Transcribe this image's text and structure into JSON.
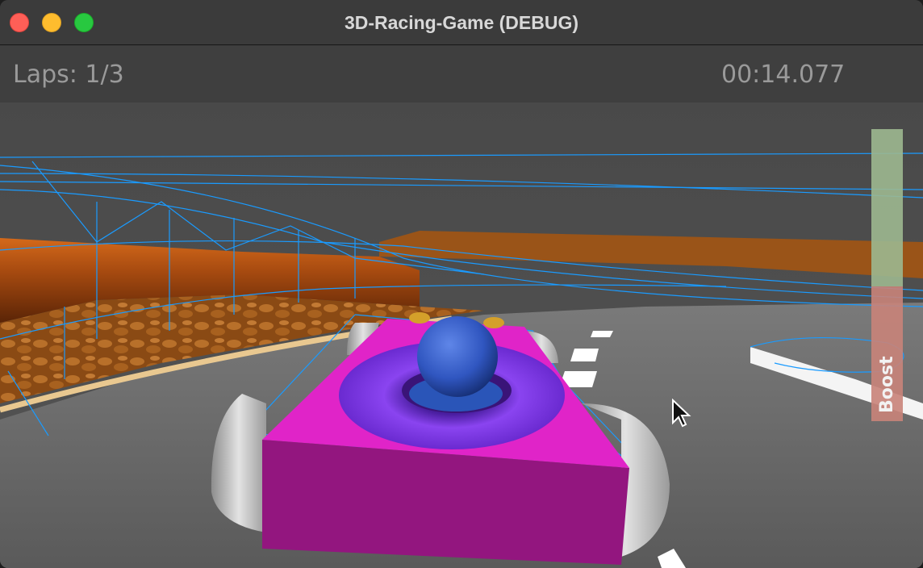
{
  "window": {
    "title": "3D-Racing-Game (DEBUG)"
  },
  "hud": {
    "laps": "Laps: 1/3",
    "timer": "00:14.077"
  },
  "boost": {
    "label": "Boost",
    "level": 0.46
  },
  "colors": {
    "kart_body": "#d61fc2",
    "kart_front": "#92157f",
    "ring": "#7a36e6",
    "driver": "#3a63cf",
    "wireframe": "#1a9bff",
    "track_wall": "#c65a14",
    "road": "#6b6b6b",
    "boost_bar": "#9db890",
    "boost_fill": "#c9847a"
  },
  "icons": {
    "cursor": "arrow-cursor-icon"
  }
}
